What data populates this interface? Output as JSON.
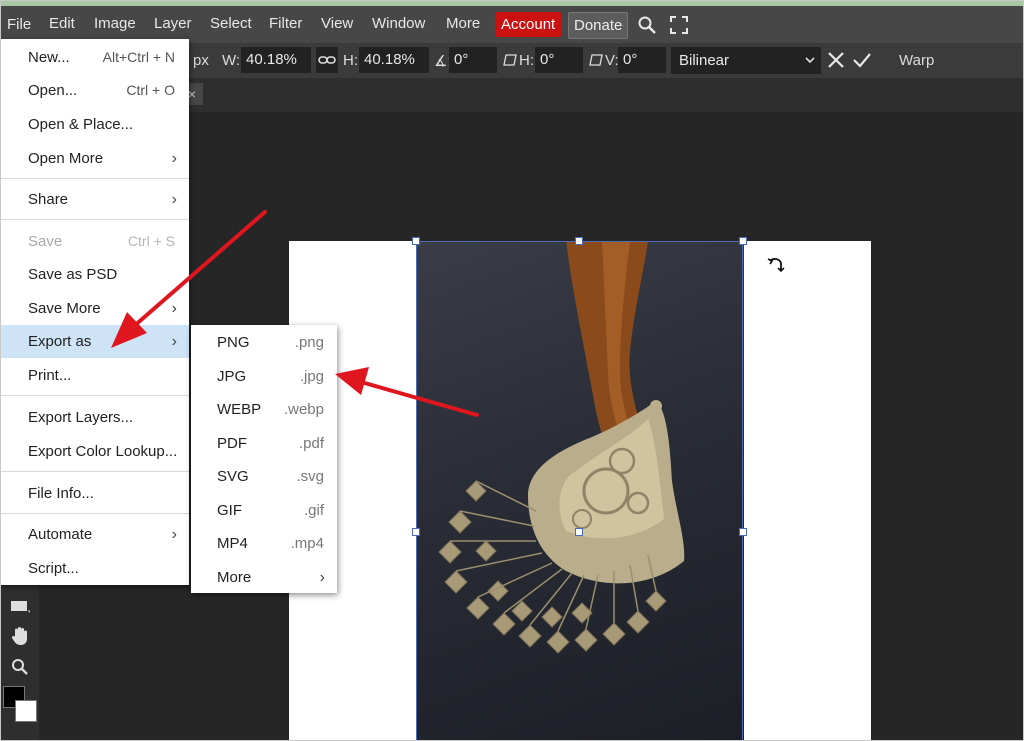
{
  "menubar": {
    "items": [
      "File",
      "Edit",
      "Image",
      "Layer",
      "Select",
      "Filter",
      "View",
      "Window",
      "More"
    ],
    "account": "Account",
    "donate": "Donate",
    "search_icon": "search-icon",
    "fullscreen_icon": "fullscreen-icon"
  },
  "options": {
    "unit": "px",
    "w_label": "W:",
    "w_value": "40.18%",
    "link_icon": "link-icon",
    "h_label": "H:",
    "h_value": "40.18%",
    "angle_label": "∡:",
    "angle_value": "0°",
    "skew_h_label": "H:",
    "skew_h_value": "0°",
    "skew_v_label": "V:",
    "skew_v_value": "0°",
    "interpolation": "Bilinear",
    "warp": "Warp"
  },
  "file_menu": {
    "items": [
      {
        "label": "New...",
        "shortcut": "Alt+Ctrl + N"
      },
      {
        "label": "Open...",
        "shortcut": "Ctrl + O"
      },
      {
        "label": "Open & Place..."
      },
      {
        "label": "Open More",
        "arrow": "›"
      },
      {
        "label": "Share",
        "arrow": "›"
      },
      {
        "label": "Save",
        "shortcut": "Ctrl + S"
      },
      {
        "label": "Save as PSD"
      },
      {
        "label": "Save More",
        "arrow": "›"
      },
      {
        "label": "Export as",
        "arrow": "›"
      },
      {
        "label": "Print..."
      },
      {
        "label": "Export Layers..."
      },
      {
        "label": "Export Color Lookup..."
      },
      {
        "label": "File Info..."
      },
      {
        "label": "Automate",
        "arrow": "›"
      },
      {
        "label": "Script..."
      }
    ]
  },
  "export_menu": {
    "items": [
      {
        "label": "PNG",
        "ext": ".png"
      },
      {
        "label": "JPG",
        "ext": ".jpg"
      },
      {
        "label": "WEBP",
        "ext": ".webp"
      },
      {
        "label": "PDF",
        "ext": ".pdf"
      },
      {
        "label": "SVG",
        "ext": ".svg"
      },
      {
        "label": "GIF",
        "ext": ".gif"
      },
      {
        "label": "MP4",
        "ext": ".mp4"
      },
      {
        "label": "More",
        "arrow": "›"
      }
    ]
  },
  "tab_close": "×",
  "colors": {
    "accent_red": "#cc1111",
    "highlight": "#cfe3f7",
    "annotation_arrow": "#e0161e"
  }
}
